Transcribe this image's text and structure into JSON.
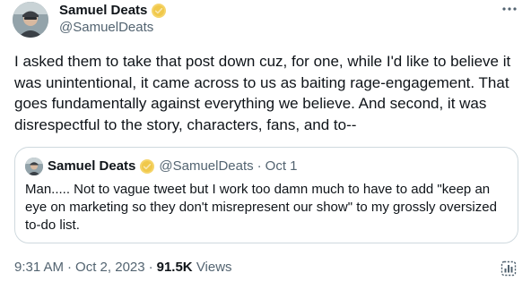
{
  "tweet": {
    "author": {
      "name": "Samuel Deats",
      "handle": "@SamuelDeats",
      "avatar": "profile-photo",
      "verified_badge": "gold-verified-icon"
    },
    "more_icon": "more-horizontal-icon",
    "text": "I asked them to take that post down cuz, for one, while I'd like to believe it was unintentional, it came across to us as baiting rage-engagement. That goes fundamentally against everything we believe. And second, it was disrespectful to the story, characters, fans, and to--",
    "quote": {
      "name": "Samuel Deats",
      "handle": "@SamuelDeats",
      "separator": "·",
      "date": "Oct 1",
      "text": "Man..... Not to vague tweet but I work too damn much to have to add \"keep an eye on marketing so they don't misrepresent our show\" to my grossly oversized to-do list."
    },
    "meta": {
      "time": "9:31 AM",
      "separator": "·",
      "date": "Oct 2, 2023",
      "views_count": "91.5K",
      "views_label": "Views"
    },
    "stats_icon": "view-analytics-icon"
  },
  "colors": {
    "text_primary": "#0f1419",
    "text_secondary": "#536471",
    "border": "#cfd9de",
    "verified_gold": "#f0c84a"
  }
}
